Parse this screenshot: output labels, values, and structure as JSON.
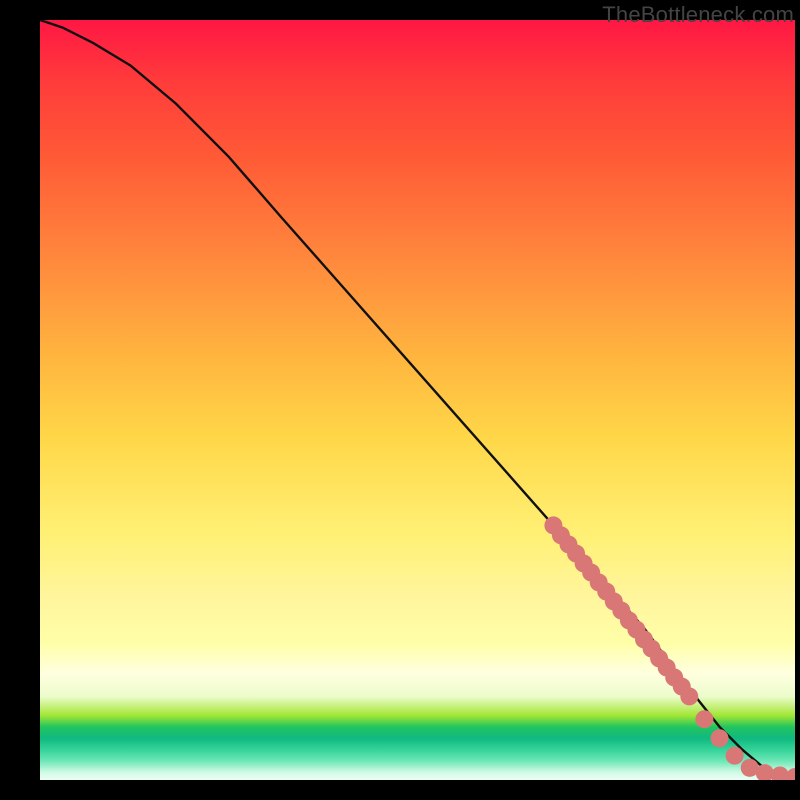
{
  "watermark": "TheBottleneck.com",
  "chart_data": {
    "type": "line",
    "title": "",
    "xlabel": "",
    "ylabel": "",
    "xlim": [
      0,
      100
    ],
    "ylim": [
      0,
      100
    ],
    "grid": false,
    "series": [
      {
        "name": "curve",
        "x": [
          0,
          3,
          7,
          12,
          18,
          25,
          32,
          40,
          48,
          56,
          64,
          72,
          80,
          86,
          90,
          93,
          96,
          98,
          100
        ],
        "y": [
          100,
          99,
          97,
          94,
          89,
          82,
          74,
          65,
          56,
          47,
          38,
          29,
          20,
          12,
          7,
          4,
          1.5,
          0.5,
          0.3
        ]
      },
      {
        "name": "markers",
        "x": [
          68,
          69,
          70,
          71,
          72,
          73,
          74,
          75,
          76,
          77,
          78,
          79,
          80,
          81,
          82,
          83,
          84,
          85,
          86,
          88,
          90,
          92,
          94,
          96,
          98,
          100
        ],
        "y": [
          33.5,
          32.2,
          31.0,
          29.8,
          28.5,
          27.3,
          26.0,
          24.8,
          23.5,
          22.3,
          21.0,
          19.8,
          18.5,
          17.3,
          16.0,
          14.8,
          13.5,
          12.3,
          11.0,
          8.0,
          5.5,
          3.2,
          1.6,
          0.9,
          0.6,
          0.4
        ]
      }
    ],
    "marker_color": "#d97777",
    "line_color": "#111111"
  }
}
